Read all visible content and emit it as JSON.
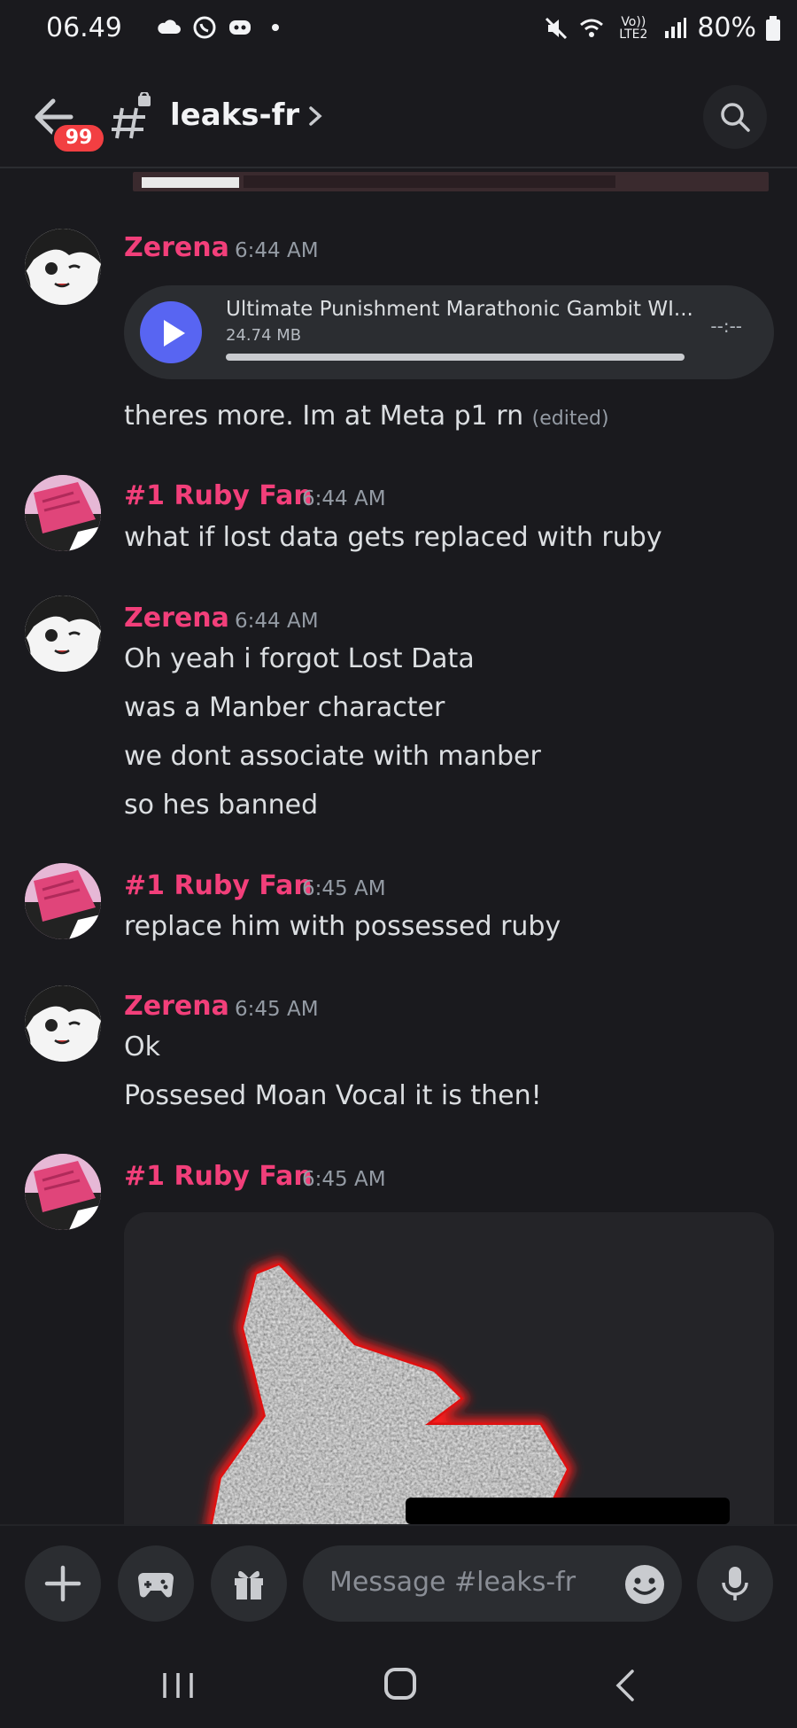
{
  "status_bar": {
    "time": "06.49",
    "battery": "80%",
    "network_label": "Vo)) LTE2"
  },
  "header": {
    "badge_count": "99",
    "channel_name": "leaks-fr"
  },
  "messages": [
    {
      "author": "Zerena",
      "time": "6:44 AM",
      "attachment": {
        "title": "Ultimate Punishment Marathonic Gambit WI...",
        "size": "24.74 MB",
        "duration": "--:--"
      },
      "lines": [
        "theres more. Im at Meta p1 rn"
      ],
      "edited": "(edited)"
    },
    {
      "author": "#1 Ruby Fan",
      "time": "6:44 AM",
      "lines": [
        "what if lost data gets replaced with ruby"
      ]
    },
    {
      "author": "Zerena",
      "time": "6:44 AM",
      "lines": [
        "Oh yeah i forgot Lost Data",
        "was a Manber character",
        "we dont associate with manber",
        "so hes banned"
      ]
    },
    {
      "author": "#1 Ruby Fan",
      "time": "6:45 AM",
      "lines": [
        "replace him with possessed ruby"
      ]
    },
    {
      "author": "Zerena",
      "time": "6:45 AM",
      "lines": [
        "Ok",
        "Possesed Moan Vocal it is then!"
      ]
    },
    {
      "author": "#1 Ruby Fan",
      "time": "6:45 AM",
      "lines": []
    }
  ],
  "composer": {
    "placeholder": "Message #leaks-fr"
  },
  "colors": {
    "background": "#1a1a1e",
    "author_pink": "#f23f7a",
    "play_blue": "#5865f2",
    "badge_red": "#f23f42"
  }
}
